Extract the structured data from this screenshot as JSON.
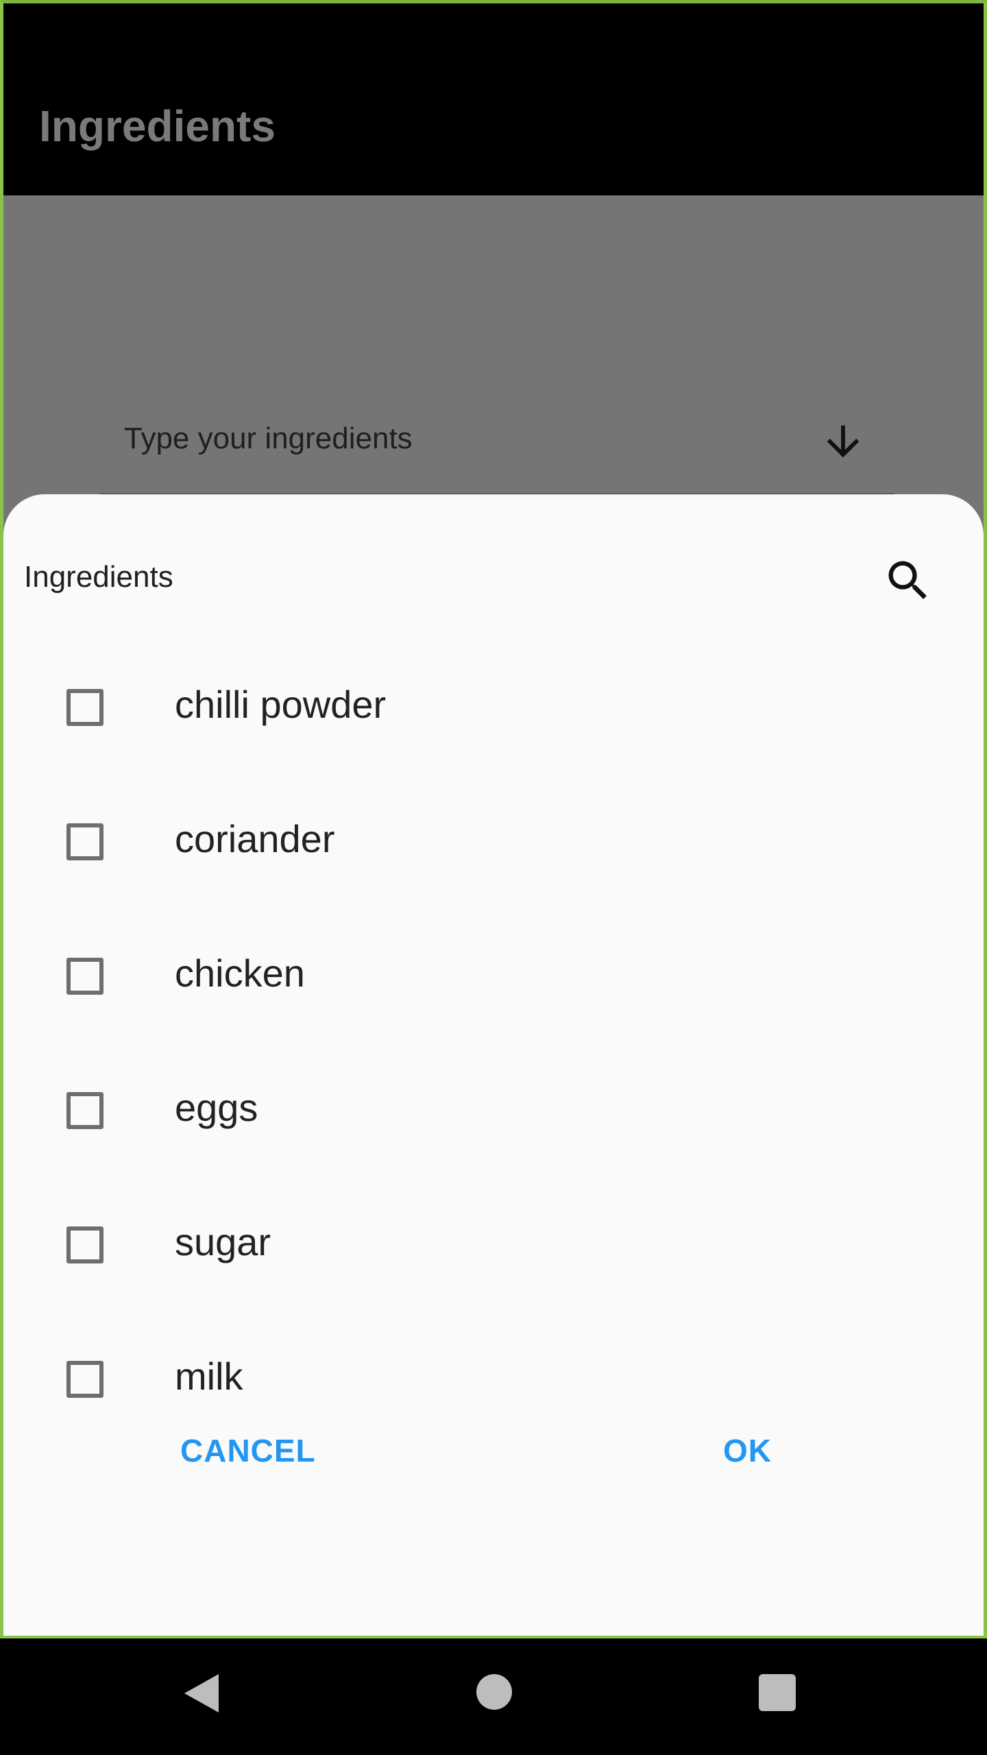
{
  "app_bar": {
    "title": "Ingredients"
  },
  "ingredient_field": {
    "placeholder": "Type your ingredients",
    "dropdown_icon": "arrow-down-icon"
  },
  "dialog": {
    "title": "Ingredients",
    "search_icon": "search-icon",
    "items": [
      {
        "label": "chilli powder",
        "checked": false
      },
      {
        "label": "coriander",
        "checked": false
      },
      {
        "label": "chicken",
        "checked": false
      },
      {
        "label": "eggs",
        "checked": false
      },
      {
        "label": "sugar",
        "checked": false
      },
      {
        "label": "milk",
        "checked": false
      }
    ],
    "cancel_label": "CANCEL",
    "ok_label": "OK"
  },
  "colors": {
    "accent": "#2196f3",
    "sheet_bg": "#fafafa",
    "scrim": "#757575"
  },
  "nav_bar": {
    "back_icon": "back-triangle-icon",
    "home_icon": "home-circle-icon",
    "recent_icon": "recents-square-icon"
  }
}
